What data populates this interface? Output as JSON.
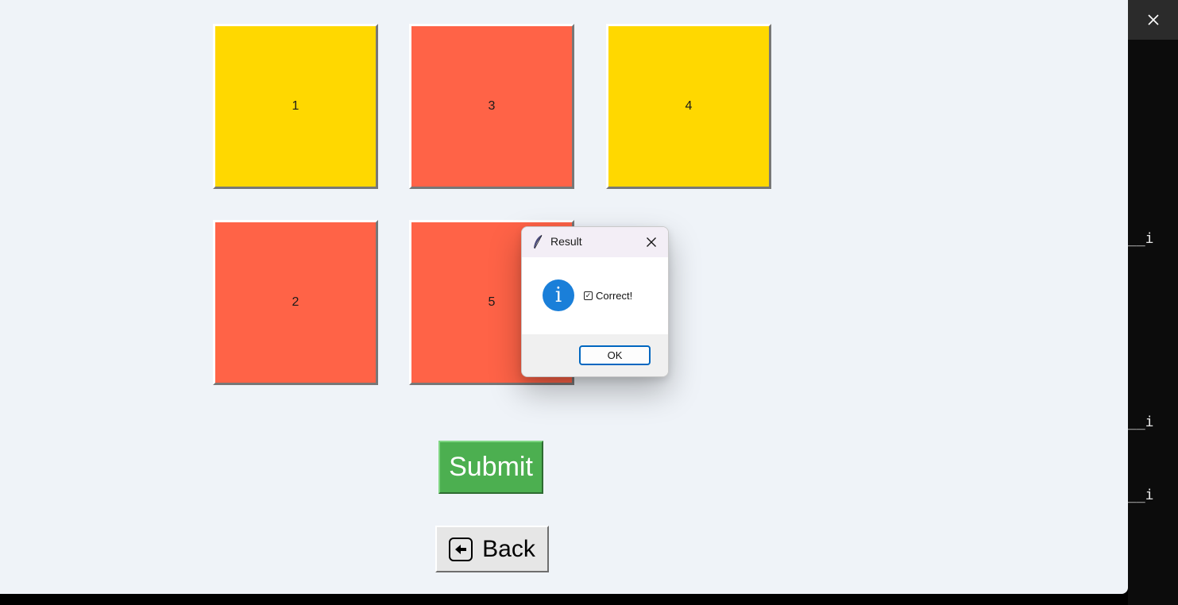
{
  "tiles": [
    {
      "label": "1",
      "color": "yellow"
    },
    {
      "label": "3",
      "color": "red"
    },
    {
      "label": "4",
      "color": "yellow"
    },
    {
      "label": "2",
      "color": "red"
    },
    {
      "label": "5",
      "color": "red"
    }
  ],
  "colors": {
    "yellow": "#ffd800",
    "red": "#ff6347",
    "submit": "#4caf50",
    "window_bg": "#eff3f8",
    "ok_border": "#0067c0",
    "info_icon": "#1a7fd9"
  },
  "buttons": {
    "submit_label": "Submit",
    "back_label": "Back"
  },
  "dialog": {
    "title": "Result",
    "message": "Correct!",
    "ok_label": "OK",
    "icon": "info-icon"
  },
  "terminal": {
    "lines": [
      "__i",
      "__i",
      "__i"
    ]
  }
}
